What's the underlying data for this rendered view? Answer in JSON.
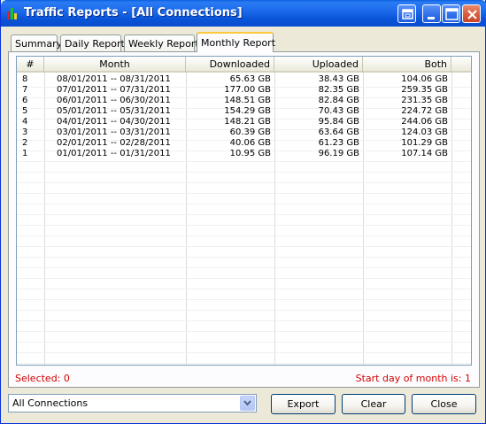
{
  "window": {
    "title": "Traffic Reports - [All Connections]"
  },
  "tabs": [
    {
      "label": "Summary",
      "active": false
    },
    {
      "label": "Daily Report",
      "active": false
    },
    {
      "label": "Weekly Report",
      "active": false
    },
    {
      "label": "Monthly Report",
      "active": true
    }
  ],
  "table": {
    "columns": [
      "#",
      "Month",
      "Downloaded",
      "Uploaded",
      "Both"
    ],
    "rows": [
      {
        "num": "8",
        "month": "08/01/2011 -- 08/31/2011",
        "downloaded": "65.63 GB",
        "uploaded": "38.43 GB",
        "both": "104.06 GB"
      },
      {
        "num": "7",
        "month": "07/01/2011 -- 07/31/2011",
        "downloaded": "177.00 GB",
        "uploaded": "82.35 GB",
        "both": "259.35 GB"
      },
      {
        "num": "6",
        "month": "06/01/2011 -- 06/30/2011",
        "downloaded": "148.51 GB",
        "uploaded": "82.84 GB",
        "both": "231.35 GB"
      },
      {
        "num": "5",
        "month": "05/01/2011 -- 05/31/2011",
        "downloaded": "154.29 GB",
        "uploaded": "70.43 GB",
        "both": "224.72 GB"
      },
      {
        "num": "4",
        "month": "04/01/2011 -- 04/30/2011",
        "downloaded": "148.21 GB",
        "uploaded": "95.84 GB",
        "both": "244.06 GB"
      },
      {
        "num": "3",
        "month": "03/01/2011 -- 03/31/2011",
        "downloaded": "60.39 GB",
        "uploaded": "63.64 GB",
        "both": "124.03 GB"
      },
      {
        "num": "2",
        "month": "02/01/2011 -- 02/28/2011",
        "downloaded": "40.06 GB",
        "uploaded": "61.23 GB",
        "both": "101.29 GB"
      },
      {
        "num": "1",
        "month": "01/01/2011 -- 01/31/2011",
        "downloaded": "10.95 GB",
        "uploaded": "96.19 GB",
        "both": "107.14 GB"
      }
    ]
  },
  "status": {
    "selected": "Selected: 0",
    "start_day": "Start day of month is: 1"
  },
  "footer": {
    "connection_select": "All Connections",
    "export_label": "Export",
    "clear_label": "Clear",
    "close_label": "Close"
  },
  "colors": {
    "titlebar": "#0a55d8",
    "status_text": "#d40000",
    "active_tab_accent": "#ffc83c"
  }
}
